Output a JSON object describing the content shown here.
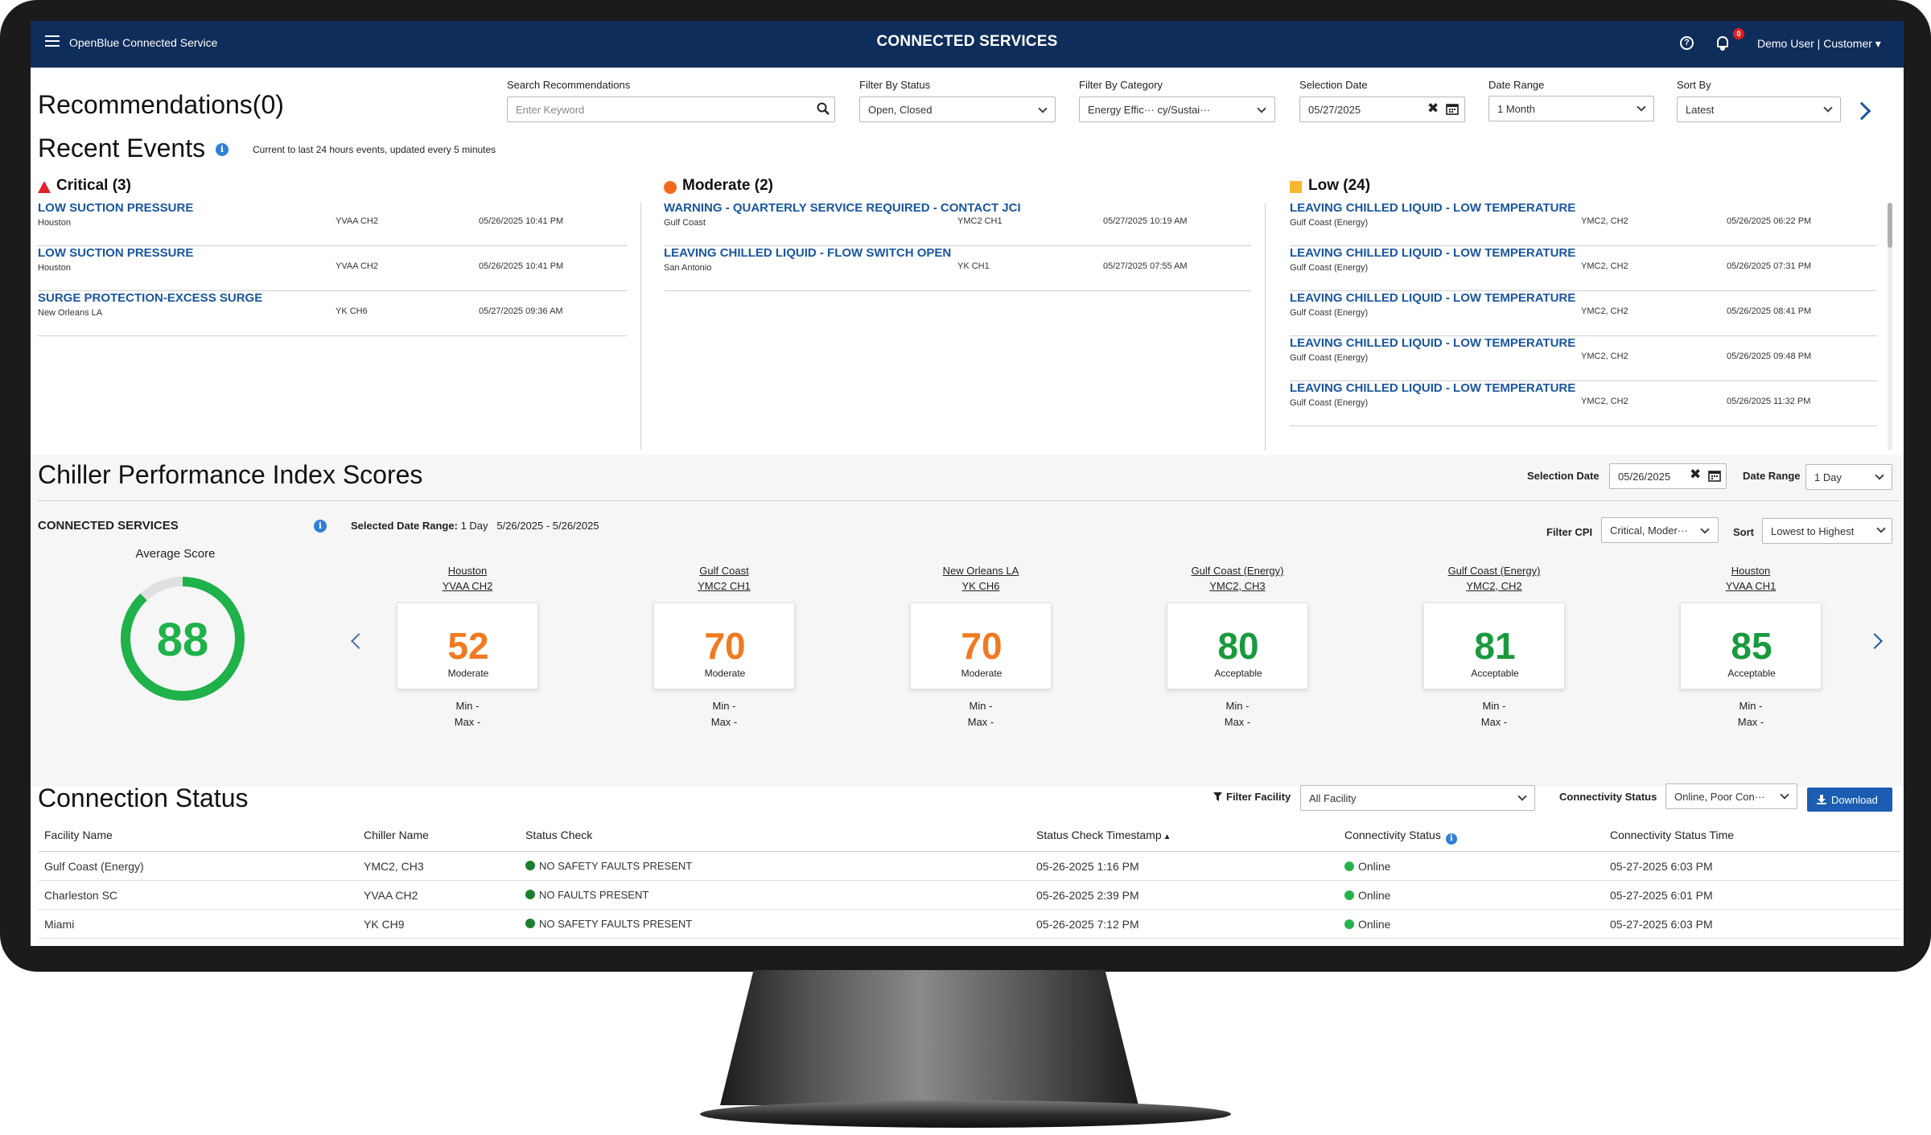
{
  "header": {
    "app_name": "OpenBlue Connected Service",
    "title": "CONNECTED SERVICES",
    "notification_count": "0",
    "user": "Demo User | Customer",
    "user_caret": "▾"
  },
  "recommendations": {
    "title": "Recommendations(0)",
    "search": {
      "label": "Search Recommendations",
      "placeholder": "Enter Keyword"
    },
    "status": {
      "label": "Filter By Status",
      "value": "Open, Closed"
    },
    "category": {
      "label": "Filter By Category",
      "value": "Energy Effic··· cy/Sustai···"
    },
    "selection_date": {
      "label": "Selection Date",
      "value": "05/27/2025"
    },
    "date_range": {
      "label": "Date Range",
      "value": "1 Month"
    },
    "sort": {
      "label": "Sort By",
      "value": "Latest"
    }
  },
  "recent_events": {
    "title": "Recent Events",
    "note": "Current to last 24 hours events, updated every 5 minutes",
    "colors": {
      "critical": "#e0202a",
      "moderate": "#f26b1d",
      "low": "#f5b82e"
    },
    "critical": {
      "label": "Critical (3)",
      "items": [
        {
          "title": "LOW SUCTION PRESSURE",
          "location": "Houston",
          "unit": "YVAA CH2",
          "time": "05/26/2025 10:41 PM"
        },
        {
          "title": "LOW SUCTION PRESSURE",
          "location": "Houston",
          "unit": "YVAA CH2",
          "time": "05/26/2025 10:41 PM"
        },
        {
          "title": "SURGE PROTECTION-EXCESS SURGE",
          "location": "New Orleans LA",
          "unit": "YK CH6",
          "time": "05/27/2025 09:36 AM"
        }
      ]
    },
    "moderate": {
      "label": "Moderate (2)",
      "items": [
        {
          "title": "WARNING - QUARTERLY SERVICE REQUIRED - CONTACT JCI",
          "location": "Gulf Coast",
          "unit": "YMC2 CH1",
          "time": "05/27/2025 10:19 AM"
        },
        {
          "title": "LEAVING CHILLED LIQUID - FLOW SWITCH OPEN",
          "location": "San Antonio",
          "unit": "YK CH1",
          "time": "05/27/2025 07:55 AM"
        }
      ]
    },
    "low": {
      "label": "Low (24)",
      "items": [
        {
          "title": "LEAVING CHILLED LIQUID - LOW TEMPERATURE",
          "location": "Gulf Coast (Energy)",
          "unit": "YMC2, CH2",
          "time": "05/26/2025 06:22 PM"
        },
        {
          "title": "LEAVING CHILLED LIQUID - LOW TEMPERATURE",
          "location": "Gulf Coast (Energy)",
          "unit": "YMC2, CH2",
          "time": "05/26/2025 07:31 PM"
        },
        {
          "title": "LEAVING CHILLED LIQUID - LOW TEMPERATURE",
          "location": "Gulf Coast (Energy)",
          "unit": "YMC2, CH2",
          "time": "05/26/2025 08:41 PM"
        },
        {
          "title": "LEAVING CHILLED LIQUID - LOW TEMPERATURE",
          "location": "Gulf Coast (Energy)",
          "unit": "YMC2, CH2",
          "time": "05/26/2025 09:48 PM"
        },
        {
          "title": "LEAVING CHILLED LIQUID - LOW TEMPERATURE",
          "location": "Gulf Coast (Energy)",
          "unit": "YMC2, CH2",
          "time": "05/26/2025 11:32 PM"
        }
      ]
    }
  },
  "cpi": {
    "title": "Chiller Performance Index Scores",
    "selection_date": {
      "label": "Selection Date",
      "value": "05/26/2025"
    },
    "date_range": {
      "label": "Date Range",
      "value": "1 Day"
    },
    "section_label": "CONNECTED SERVICES",
    "selected_range_label": "Selected Date Range:",
    "selected_range_value": "1 Day   5/26/2025 - 5/26/2025",
    "filter": {
      "label": "Filter CPI",
      "value": "Critical, Moder···"
    },
    "sort": {
      "label": "Sort",
      "value": "Lowest to Highest"
    },
    "average": {
      "label": "Average Score",
      "value": "88",
      "fraction": 0.88,
      "color": "#1fb14a"
    },
    "min_label": "Min -",
    "max_label": "Max -",
    "colors": {
      "moderate": "#f07a1f",
      "acceptable": "#1a9a3e"
    },
    "cards": [
      {
        "site": "Houston",
        "unit": "YVAA CH2",
        "score": "52",
        "rating": "Moderate",
        "level": "moderate"
      },
      {
        "site": "Gulf Coast",
        "unit": "YMC2 CH1",
        "score": "70",
        "rating": "Moderate",
        "level": "moderate"
      },
      {
        "site": "New Orleans LA",
        "unit": "YK CH6",
        "score": "70",
        "rating": "Moderate",
        "level": "moderate"
      },
      {
        "site": "Gulf Coast (Energy)",
        "unit": "YMC2, CH3",
        "score": "80",
        "rating": "Acceptable",
        "level": "acceptable"
      },
      {
        "site": "Gulf Coast (Energy)",
        "unit": "YMC2, CH2",
        "score": "81",
        "rating": "Acceptable",
        "level": "acceptable"
      },
      {
        "site": "Houston",
        "unit": "YVAA CH1",
        "score": "85",
        "rating": "Acceptable",
        "level": "acceptable"
      }
    ]
  },
  "connection_status": {
    "title": "Connection Status",
    "filter_facility": {
      "label": "Filter Facility",
      "value": "All Facility"
    },
    "connectivity": {
      "label": "Connectivity Status",
      "value": "Online, Poor Con···"
    },
    "download_label": "Download",
    "columns": [
      "Facility Name",
      "Chiller Name",
      "Status Check",
      "Status Check Timestamp",
      "Connectivity Status",
      "Connectivity Status Time"
    ],
    "sort_indicator": "▲",
    "status_colors": {
      "ok": "#1e7d2e",
      "online": "#25b34b"
    },
    "rows": [
      {
        "facility": "Gulf Coast (Energy)",
        "chiller": "YMC2, CH3",
        "status": "NO SAFETY FAULTS PRESENT",
        "timestamp": "05-26-2025 1:16 PM",
        "connectivity": "Online",
        "conn_time": "05-27-2025 6:03 PM"
      },
      {
        "facility": "Charleston SC",
        "chiller": "YVAA CH2",
        "status": "NO FAULTS PRESENT",
        "timestamp": "05-26-2025 2:39 PM",
        "connectivity": "Online",
        "conn_time": "05-27-2025 6:01 PM"
      },
      {
        "facility": "Miami",
        "chiller": "YK CH9",
        "status": "NO SAFETY FAULTS PRESENT",
        "timestamp": "05-26-2025 7:12 PM",
        "connectivity": "Online",
        "conn_time": "05-27-2025 6:03 PM"
      }
    ]
  }
}
